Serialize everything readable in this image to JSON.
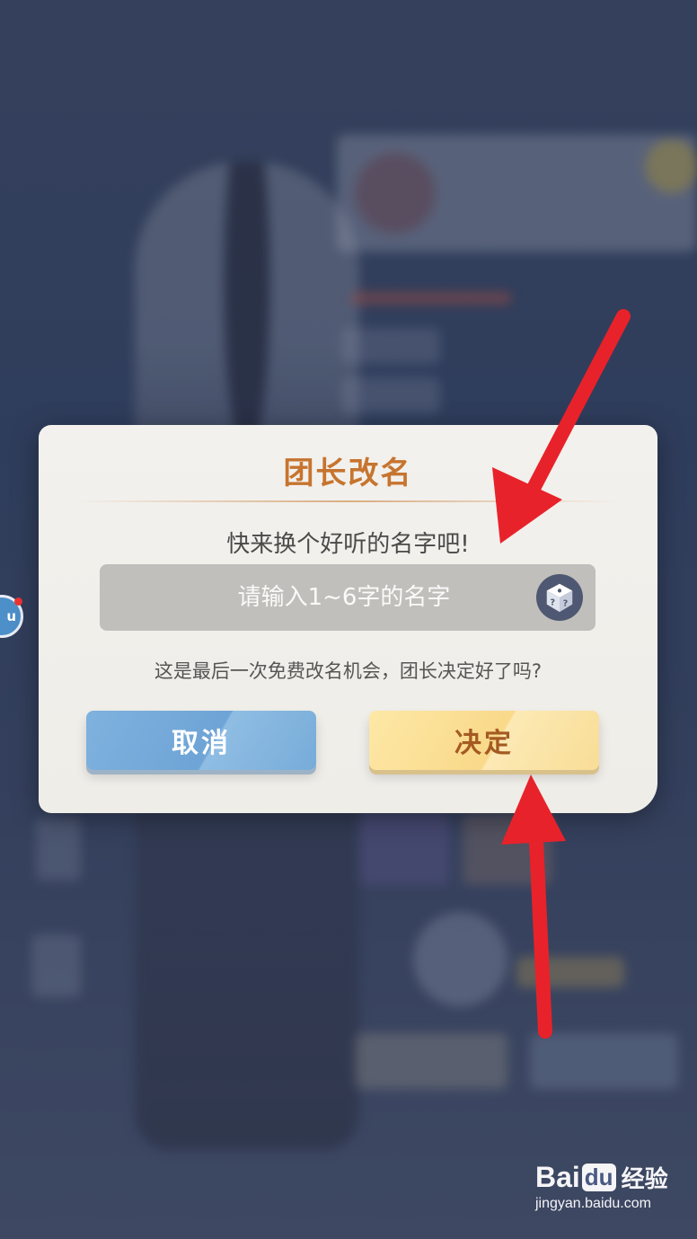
{
  "dialog": {
    "title": "团长改名",
    "prompt": "快来换个好听的名字吧!",
    "input_placeholder": "请输入1~6字的名字",
    "input_value": "",
    "warning": "这是最后一次免费改名机会，团长决定好了吗?",
    "cancel_label": "取消",
    "confirm_label": "决定"
  },
  "side_bubble": {
    "label": "u"
  },
  "watermark": {
    "brand_pre": "Bai",
    "brand_du": "du",
    "brand_post": "经验",
    "url": "jingyan.baidu.com"
  },
  "icons": {
    "dice": "dice-icon",
    "arrow": "red-arrow-annotation"
  },
  "colors": {
    "title": "#c6742f",
    "cancel_button": "#75aad9",
    "confirm_button": "#f9db8f",
    "confirm_text": "#a45a22",
    "annotation_arrow": "#e8222a"
  }
}
